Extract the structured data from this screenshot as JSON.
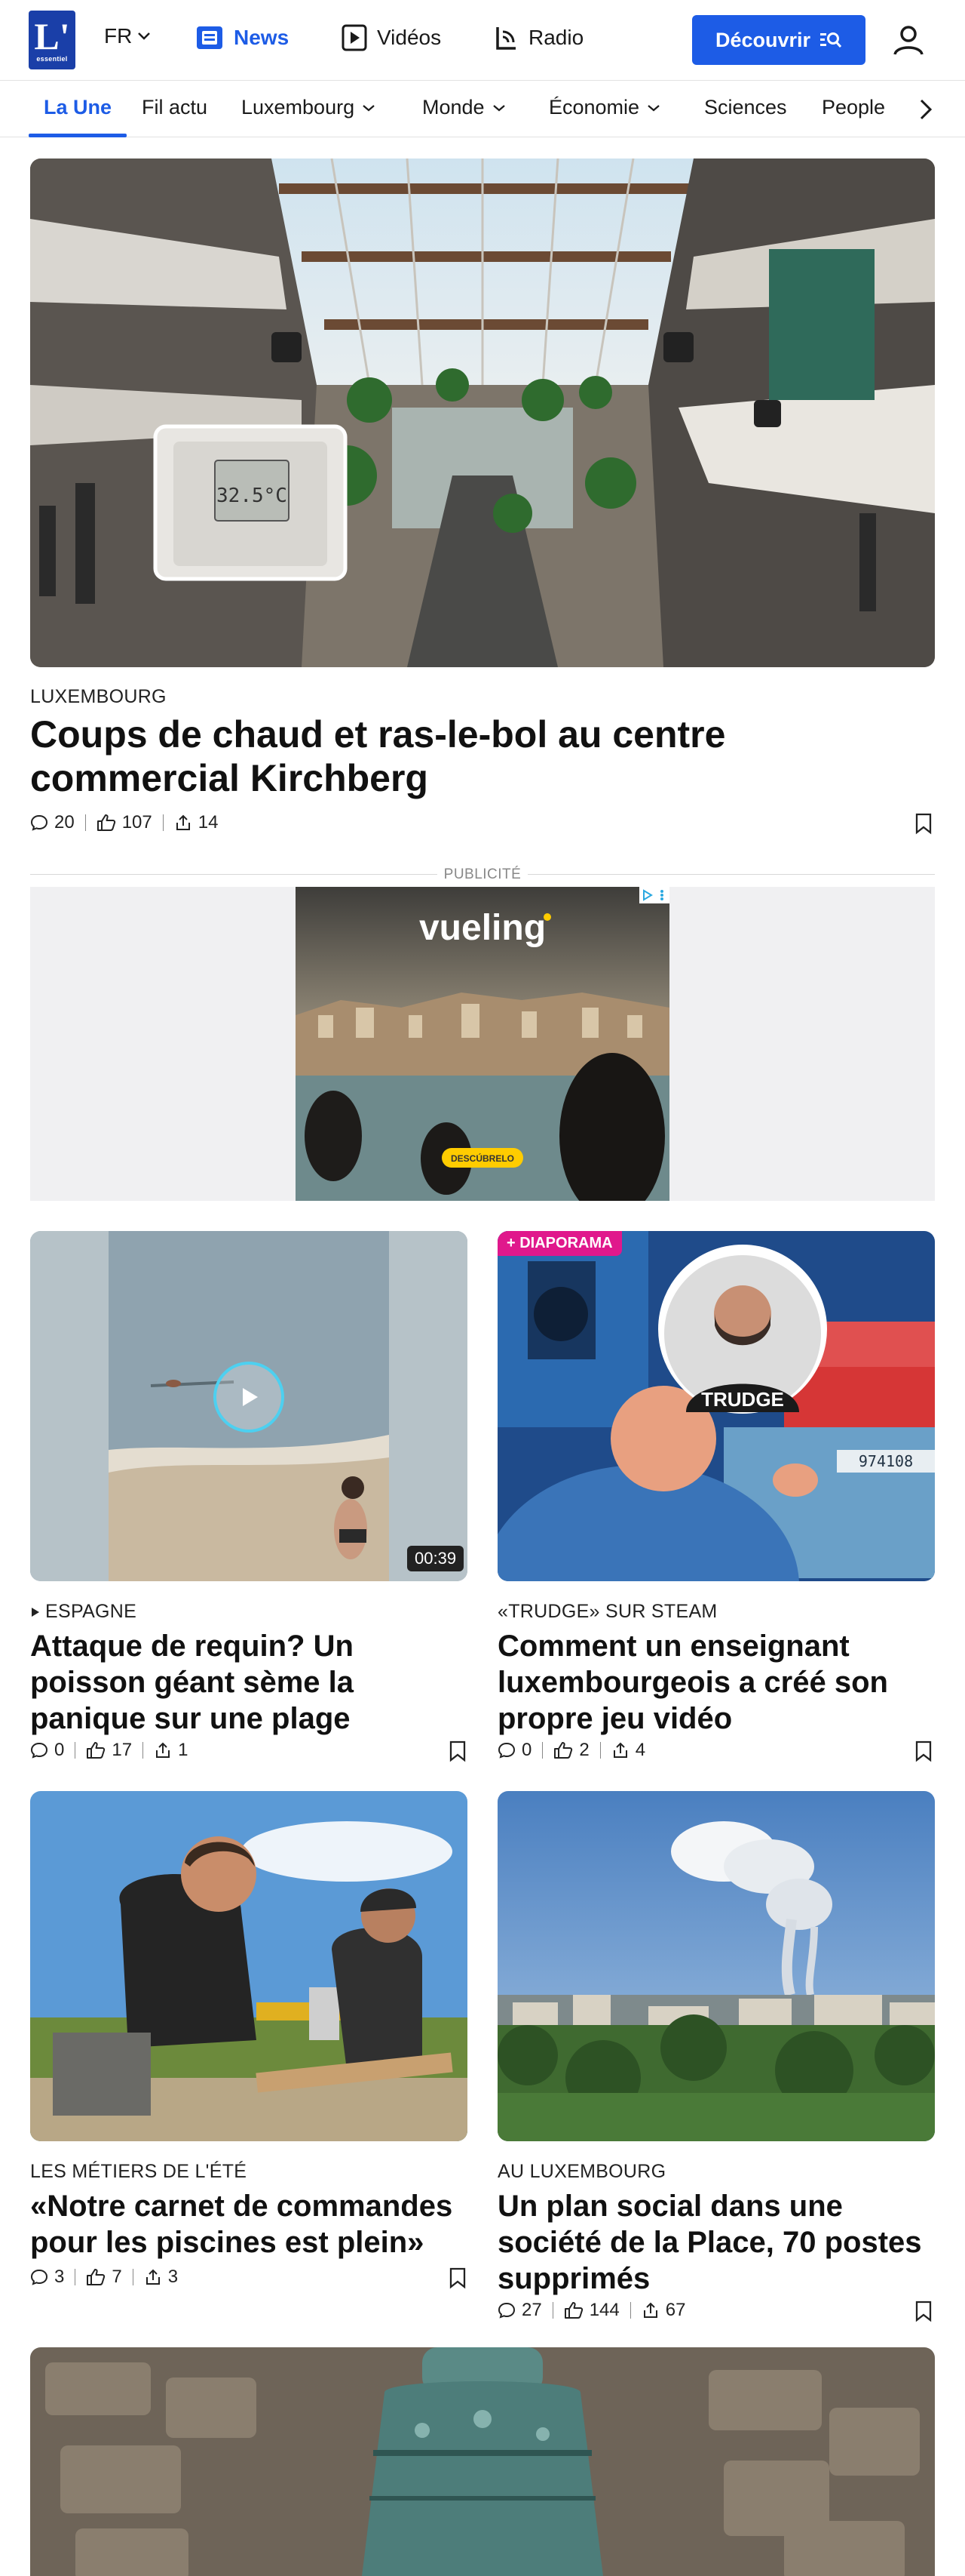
{
  "header": {
    "logo_big": "L'",
    "logo_small": "essentiel",
    "lang": "FR",
    "nav": [
      {
        "label": "News",
        "active": true
      },
      {
        "label": "Vidéos",
        "active": false
      },
      {
        "label": "Radio",
        "active": false
      }
    ],
    "discover_label": "Découvrir"
  },
  "tabs": [
    "La Une",
    "Fil actu",
    "Luxembourg",
    "Monde",
    "Économie",
    "Sciences",
    "People"
  ],
  "hero": {
    "kicker": "LUXEMBOURG",
    "title": "Coups de chaud et ras-le-bol au centre commercial Kirchberg",
    "comments": "20",
    "likes": "107",
    "shares": "14",
    "thermostat": "32.5°C"
  },
  "ad": {
    "label": "PUBLICITÉ",
    "brand": "vueling",
    "cta": "DESCÚBRELO"
  },
  "articles": [
    {
      "kicker": "ESPAGNE",
      "title": "Attaque de requin? Un poisson géant sème la panique sur une plage",
      "comments": "0",
      "likes": "17",
      "shares": "1",
      "duration": "00:39"
    },
    {
      "kicker": "«TRUDGE» SUR STEAM",
      "title": "Comment un enseignant luxembourgeois a créé son propre jeu vidéo",
      "comments": "0",
      "likes": "2",
      "shares": "4",
      "badge": "+ DIAPORAMA",
      "shirt": "TRUDGE",
      "panel": "974108"
    },
    {
      "kicker": "LES MÉTIERS DE L'ÉTÉ",
      "title": "«Notre carnet de commandes pour les piscines est plein»",
      "comments": "3",
      "likes": "7",
      "shares": "3"
    },
    {
      "kicker": "AU LUXEMBOURG",
      "title": "Un plan social dans une société de la Place, 70 postes supprimés",
      "comments": "27",
      "likes": "144",
      "shares": "67"
    }
  ],
  "colors": {
    "accent": "#1d5ce6",
    "badge": "#e0188c",
    "brand": "#1a3fa8"
  }
}
